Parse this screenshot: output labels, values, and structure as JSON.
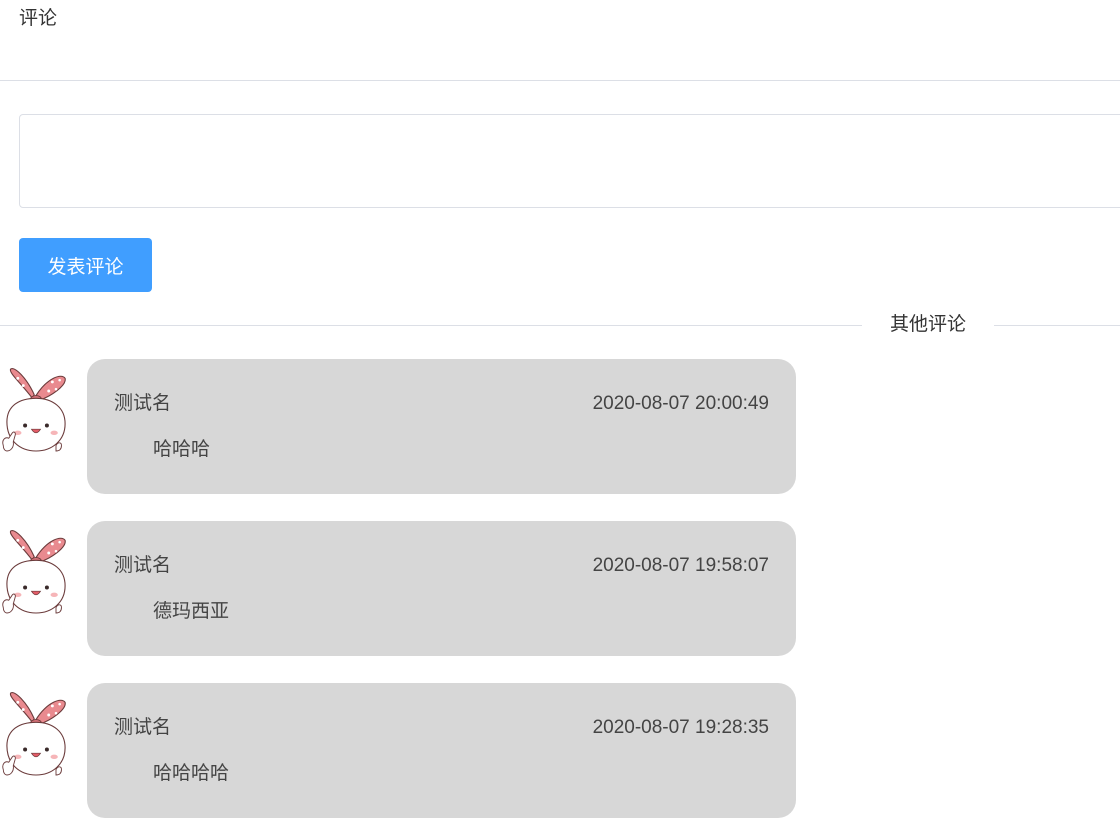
{
  "header": {
    "title": "评论"
  },
  "form": {
    "input_value": "",
    "input_placeholder": "",
    "submit_label": "发表评论"
  },
  "section": {
    "title": "其他评论"
  },
  "comments": [
    {
      "author": "测试名",
      "time": "2020-08-07 20:00:49",
      "content": "哈哈哈",
      "avatar_icon": "cartoon-bunny-avatar"
    },
    {
      "author": "测试名",
      "time": "2020-08-07 19:58:07",
      "content": "德玛西亚",
      "avatar_icon": "cartoon-bunny-avatar"
    },
    {
      "author": "测试名",
      "time": "2020-08-07 19:28:35",
      "content": "哈哈哈哈",
      "avatar_icon": "cartoon-bunny-avatar"
    }
  ],
  "colors": {
    "primary": "#409eff",
    "bubble": "#d7d7d7",
    "divider": "#dcdfe6",
    "text": "#333333"
  }
}
